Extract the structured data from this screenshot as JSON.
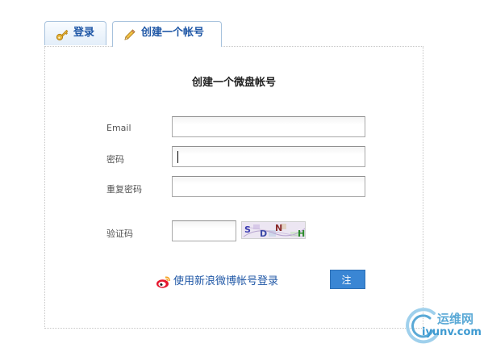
{
  "tabs": {
    "login": {
      "label": "登录",
      "icon": "key-icon"
    },
    "register": {
      "label": "创建一个帐号",
      "icon": "pencil-icon",
      "active": true
    }
  },
  "form": {
    "title": "创建一个微盘帐号",
    "email_label": "Email",
    "email_value": "",
    "password_label": "密码",
    "password_value": "",
    "confirm_label": "重复密码",
    "confirm_value": "",
    "captcha_label": "验证码",
    "captcha_value": "",
    "captcha_chars": [
      "S",
      "D",
      "N",
      "H"
    ]
  },
  "actions": {
    "weibo_login": "使用新浪微博帐号登录",
    "weibo_icon": "weibo-icon",
    "register_button": "注 册"
  },
  "watermark": {
    "cn": "运维网",
    "en": "iyunv.com"
  },
  "colors": {
    "link": "#1f57a6",
    "button": "#3a86d4",
    "tab_border": "#a7c2dd"
  }
}
